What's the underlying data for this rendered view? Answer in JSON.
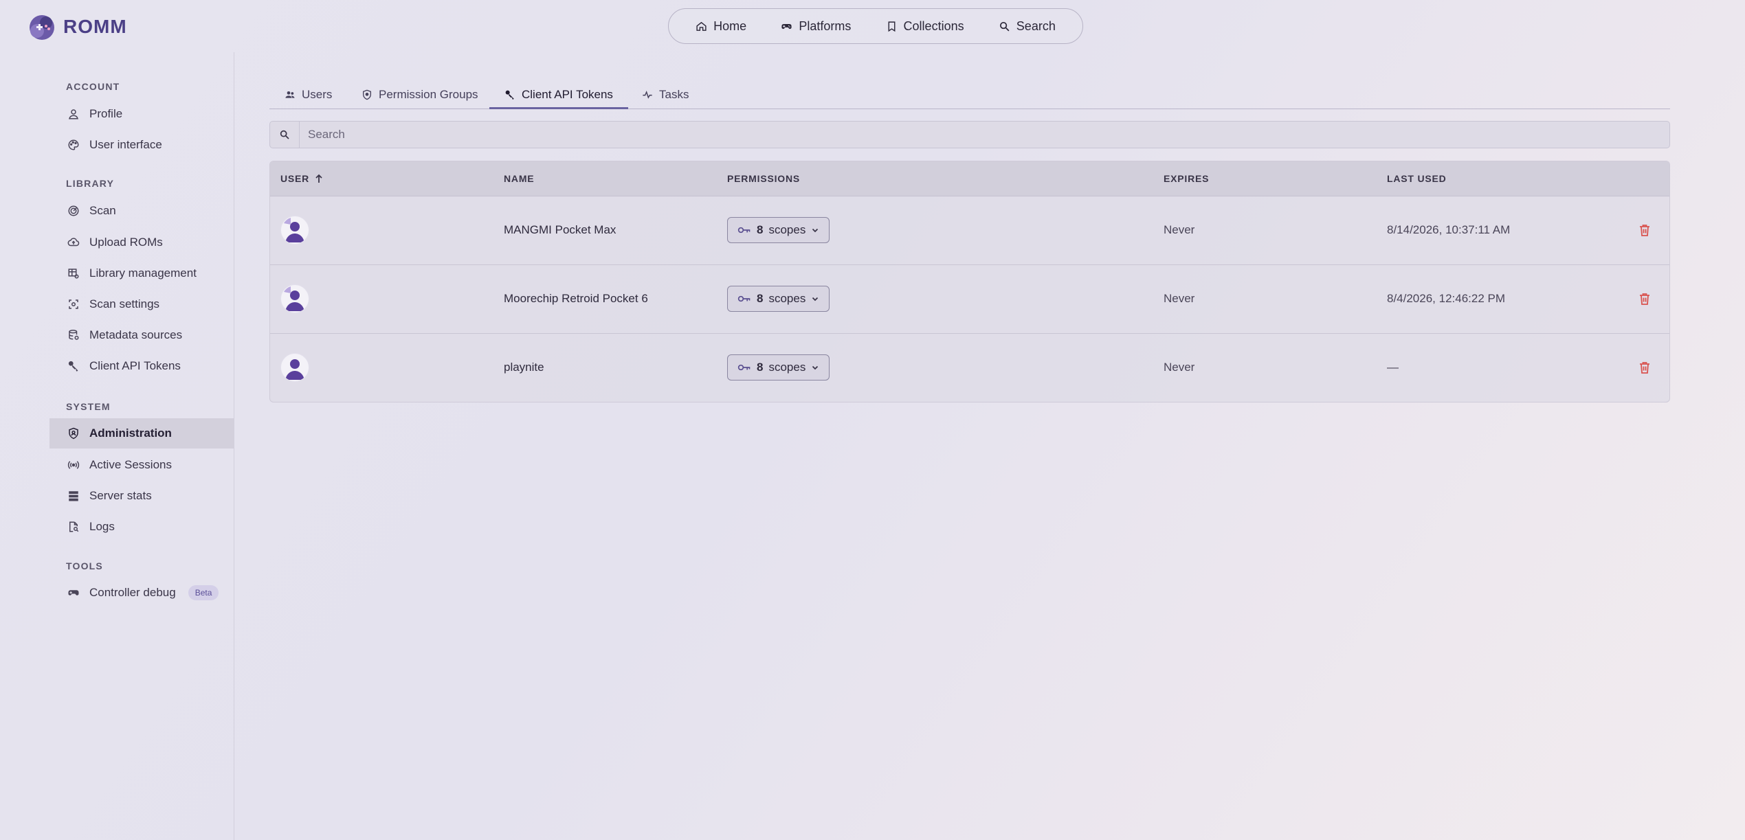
{
  "app": {
    "name": "ROMM"
  },
  "nav": [
    {
      "label": "Home",
      "icon": "home-icon"
    },
    {
      "label": "Platforms",
      "icon": "gamepad-icon"
    },
    {
      "label": "Collections",
      "icon": "bookmark-icon"
    },
    {
      "label": "Search",
      "icon": "search-icon"
    }
  ],
  "sidebar": {
    "account_label": "ACCOUNT",
    "library_label": "LIBRARY",
    "system_label": "SYSTEM",
    "tools_label": "TOOLS",
    "items": {
      "profile": "Profile",
      "user_interface": "User interface",
      "scan": "Scan",
      "upload_roms": "Upload ROMs",
      "library_management": "Library management",
      "scan_settings": "Scan settings",
      "metadata_sources": "Metadata sources",
      "client_api_tokens": "Client API Tokens",
      "administration": "Administration",
      "active_sessions": "Active Sessions",
      "server_stats": "Server stats",
      "logs": "Logs",
      "controller_debug": "Controller debug"
    },
    "beta_badge": "Beta",
    "active_item": "Administration"
  },
  "tabs": {
    "users": "Users",
    "permission_groups": "Permission Groups",
    "client_api_tokens": "Client API Tokens",
    "tasks": "Tasks",
    "active": "Client API Tokens"
  },
  "search": {
    "placeholder": "Search",
    "value": ""
  },
  "table": {
    "headers": {
      "user": "USER",
      "name": "NAME",
      "permissions": "PERMISSIONS",
      "expires": "EXPIRES",
      "last_used": "LAST USED"
    },
    "sort": {
      "column": "USER",
      "direction": "ascending"
    },
    "rows": [
      {
        "name": "MANGMI Pocket Max",
        "scopes_count": "8",
        "scopes_label": "scopes",
        "expires": "Never",
        "last_used": "8/14/2026, 10:37:11 AM"
      },
      {
        "name": "Moorechip Retroid Pocket 6",
        "scopes_count": "8",
        "scopes_label": "scopes",
        "expires": "Never",
        "last_used": "8/4/2026, 12:46:22 PM"
      },
      {
        "name": "playnite",
        "scopes_count": "8",
        "scopes_label": "scopes",
        "expires": "Never",
        "last_used": "—"
      }
    ]
  },
  "colors": {
    "accent": "#6a63a0",
    "brand": "#4b3f86",
    "danger": "#d9534f"
  }
}
